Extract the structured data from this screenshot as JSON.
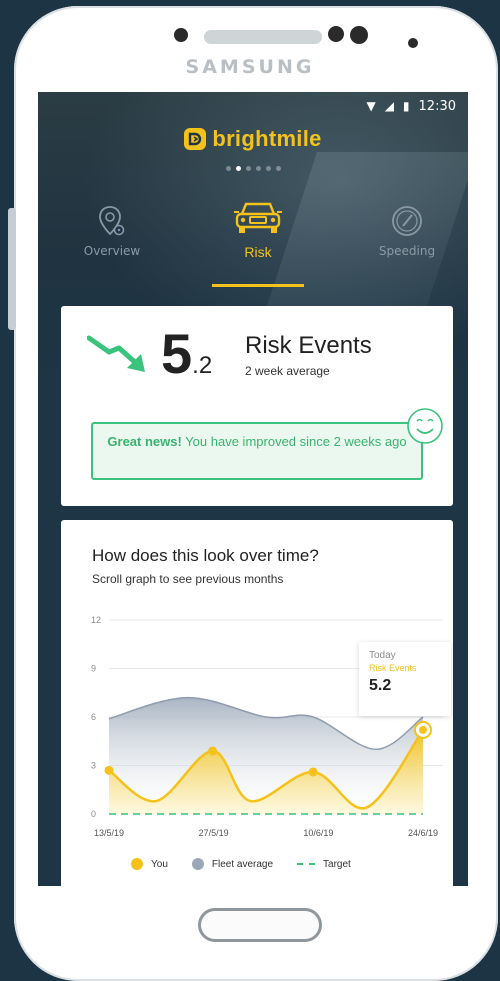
{
  "device": {
    "brand": "SAMSUNG"
  },
  "status_bar": {
    "time": "12:30"
  },
  "app": {
    "logo_text": "brightmile"
  },
  "pager": {
    "count": 6,
    "active_index": 1
  },
  "tabs": [
    {
      "label": "Overview",
      "icon": "location-pin-icon",
      "active": false
    },
    {
      "label": "Risk",
      "icon": "car-icon",
      "active": true
    },
    {
      "label": "Speeding",
      "icon": "speedometer-icon",
      "active": false
    }
  ],
  "risk_card": {
    "value_int": "5",
    "value_dec": ".2",
    "title": "Risk Events",
    "subtitle": "2 week average",
    "trend_icon": "trend-down-arrow-icon",
    "news_bold": "Great news!",
    "news_rest": " You have improved since 2 weeks ago",
    "mood_icon": "smiley-icon"
  },
  "colors": {
    "accent_yellow": "#f4c21b",
    "good_green": "#39c37c",
    "fleet_gray": "#9aa8b8",
    "background": "#1c3443"
  },
  "over_time_card": {
    "title": "How does this look over time?",
    "subtitle": "Scroll graph to see previous months",
    "tooltip": {
      "label": "Today",
      "series": "Risk Events",
      "value": "5.2"
    },
    "legend": {
      "you": "You",
      "fleet": "Fleet average",
      "target": "Target"
    }
  },
  "chart_data": {
    "type": "area",
    "x_tick_labels": [
      "13/5/19",
      "27/5/19",
      "10/6/19",
      "24/6/19"
    ],
    "y_ticks": [
      "12",
      "9",
      "6",
      "3",
      "0"
    ],
    "ylim": [
      0,
      12
    ],
    "grid": true,
    "series": [
      {
        "name": "Fleet average",
        "points": [
          [
            0,
            5.9
          ],
          [
            0.25,
            7.2
          ],
          [
            0.5,
            6.0
          ],
          [
            0.65,
            6.0
          ],
          [
            0.85,
            4.0
          ],
          [
            1.0,
            6.0
          ]
        ]
      },
      {
        "name": "You",
        "points": [
          [
            0,
            2.7
          ],
          [
            0.15,
            0.8
          ],
          [
            0.33,
            3.9
          ],
          [
            0.45,
            0.8
          ],
          [
            0.65,
            2.6
          ],
          [
            0.82,
            0.4
          ],
          [
            1.0,
            5.2
          ]
        ]
      },
      {
        "name": "Target",
        "points": [
          [
            0,
            0
          ],
          [
            1.0,
            0
          ]
        ]
      }
    ]
  }
}
